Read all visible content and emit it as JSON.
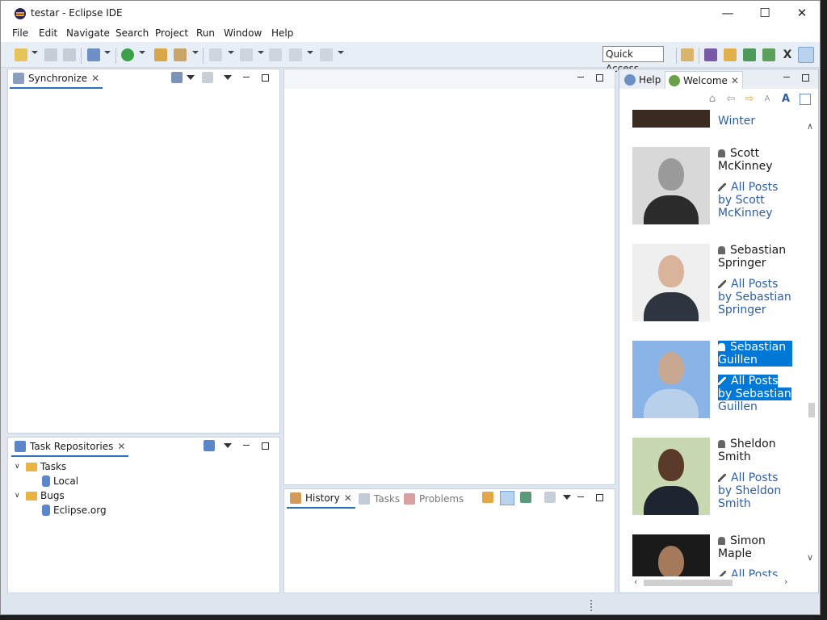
{
  "window": {
    "title": "testar - Eclipse IDE"
  },
  "menu": [
    "File",
    "Edit",
    "Navigate",
    "Search",
    "Project",
    "Run",
    "Window",
    "Help"
  ],
  "toolbar": {
    "quick_access": "Quick Access"
  },
  "synchronize": {
    "tab": "Synchronize"
  },
  "task_repositories": {
    "tab": "Task Repositories",
    "tree": [
      {
        "label": "Tasks",
        "children": [
          "Local"
        ]
      },
      {
        "label": "Bugs",
        "children": [
          "Eclipse.org"
        ]
      }
    ]
  },
  "bottom_tabs": {
    "history": "History",
    "tasks": "Tasks",
    "problems": "Problems"
  },
  "right_tabs": {
    "help": "Help",
    "welcome": "Welcome"
  },
  "welcome": {
    "partial_name": "Winter",
    "people": [
      {
        "name": "Scott McKinney",
        "posts": "All Posts by Scott McKinney"
      },
      {
        "name": "Sebastian Springer",
        "posts": "All Posts by Sebastian Springer"
      },
      {
        "name": "Sebastian Guillen",
        "posts_selected": "All Posts by Sebastian",
        "posts_rest": "Guillen"
      },
      {
        "name": "Sheldon Smith",
        "posts": "All Posts by Sheldon Smith"
      },
      {
        "name": "Simon Maple",
        "posts": "All Posts by Simon"
      }
    ]
  }
}
